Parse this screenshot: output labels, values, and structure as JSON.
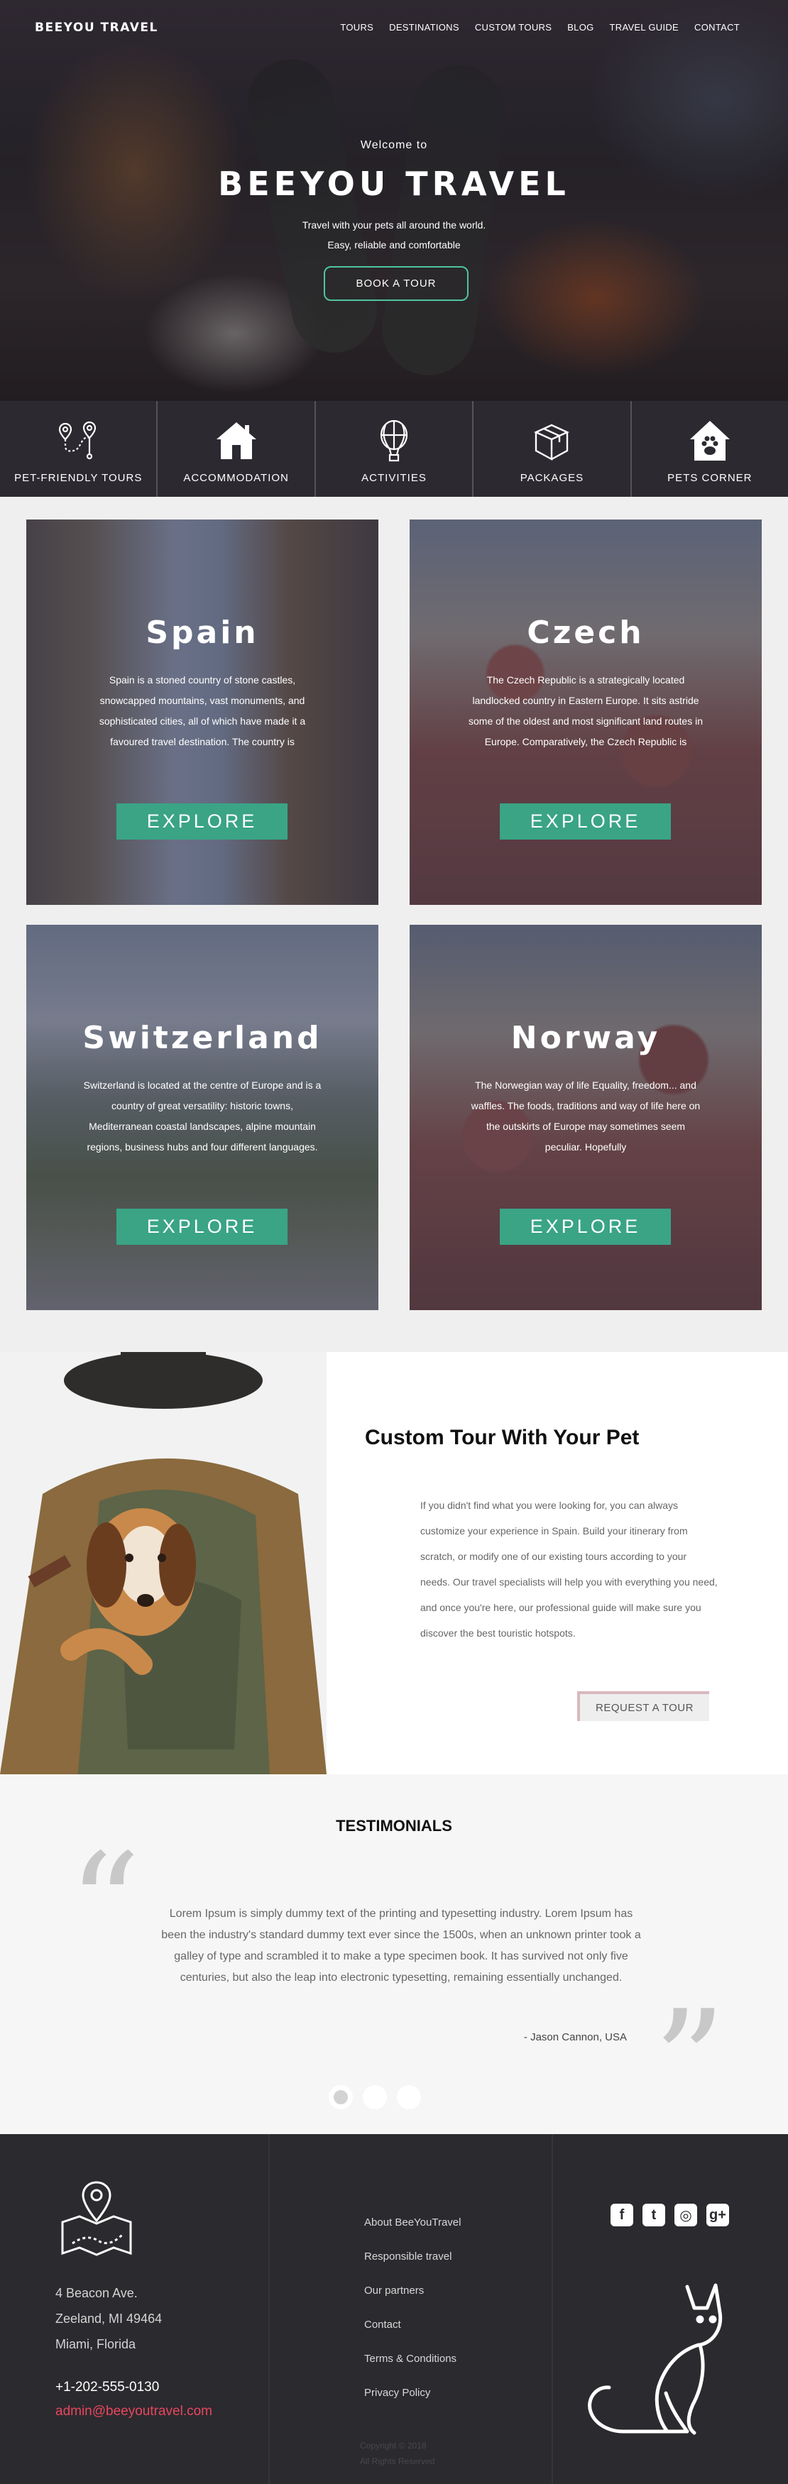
{
  "brand": {
    "logo_text": "BEEYOU TRAVEL"
  },
  "nav": {
    "items": [
      "TOURS",
      "DESTINATIONS",
      "CUSTOM TOURS",
      "BLOG",
      "TRAVEL GUIDE",
      "CONTACT"
    ]
  },
  "hero": {
    "welcome": "Welcome to",
    "title": "BEEYOU TRAVEL",
    "subtitle_line1": "Travel with your pets all around the world.",
    "subtitle_line2": "Easy, reliable and comfortable",
    "button": "BOOK A TOUR"
  },
  "categories": [
    {
      "label": "PET-FRIENDLY TOURS",
      "icon": "route-pin-icon"
    },
    {
      "label": "ACCOMMODATION",
      "icon": "house-icon"
    },
    {
      "label": "ACTIVITIES",
      "icon": "hot-air-balloon-icon"
    },
    {
      "label": "PACKAGES",
      "icon": "box-icon"
    },
    {
      "label": "PETS CORNER",
      "icon": "paw-house-icon"
    }
  ],
  "destinations": [
    {
      "name": "Spain",
      "text": "Spain is a stoned country of stone castles, snowcapped mountains, vast monuments, and sophisticated cities, all of which have made it a favoured travel destination. The country is",
      "button": "EXPLORE"
    },
    {
      "name": "Czech",
      "text": "The Czech Republic is a strategically located landlocked country in Eastern Europe. It sits astride some of the oldest and most significant land routes in Europe. Comparatively, the Czech Republic is",
      "button": "EXPLORE"
    },
    {
      "name": "Switzerland",
      "text": "Switzerland is located at the centre of Europe and is a country of great versatility: historic towns, Mediterranean coastal landscapes, alpine mountain regions, business hubs and four different languages.",
      "button": "EXPLORE"
    },
    {
      "name": "Norway",
      "text": "The Norwegian way of life Equality, freedom... and waffles. The foods, traditions and way of life here on the outskirts of Europe may sometimes seem peculiar. Hopefully",
      "button": "EXPLORE"
    }
  ],
  "custom_tour": {
    "title": "Custom Tour With Your Pet",
    "text": "If you didn't find what you were looking for, you can always customize your experience in Spain. Build your itinerary from scratch, or modify one of our existing tours according to your needs. Our travel specialists will help you with everything you need, and once you're here, our professional guide will make sure you discover the best touristic hotspots.",
    "button": "REQUEST A TOUR"
  },
  "testimonials": {
    "title": "TESTIMONIALS",
    "text": "Lorem Ipsum is simply dummy text of the printing and typesetting industry. Lorem Ipsum has been the industry's standard dummy text ever since the 1500s, when an unknown printer took a galley of type and scrambled it to make a type specimen book. It has survived not only five centuries, but also the leap into electronic typesetting, remaining essentially unchanged.",
    "author": "- Jason Cannon,  USA",
    "slide_count": 3,
    "active_slide": 1
  },
  "footer": {
    "address_line1": "4 Beacon Ave.",
    "address_line2": "Zeeland, MI 49464",
    "address_line3": "Miami, Florida",
    "phone": "+1-202-555-0130",
    "email": "admin@beeyoutravel.com",
    "links": [
      "About BeeYouTravel",
      "Responsible travel",
      "Our partners",
      "Contact",
      "Terms & Conditions",
      "Privacy Policy"
    ],
    "copyright_line1": "Copyright © 2018",
    "copyright_line2": "All Rights Reserved",
    "social": [
      {
        "icon": "facebook-icon",
        "glyph": "f"
      },
      {
        "icon": "twitter-icon",
        "glyph": "t"
      },
      {
        "icon": "instagram-icon",
        "glyph": "◎"
      },
      {
        "icon": "google-plus-icon",
        "glyph": "g+"
      }
    ]
  },
  "colors": {
    "accent_green": "#3aa485",
    "hero_button_border": "#4fc5a0",
    "email_red": "#e8465f",
    "footer_bg": "#2b2a2e",
    "category_bg": "#2c2a30"
  }
}
